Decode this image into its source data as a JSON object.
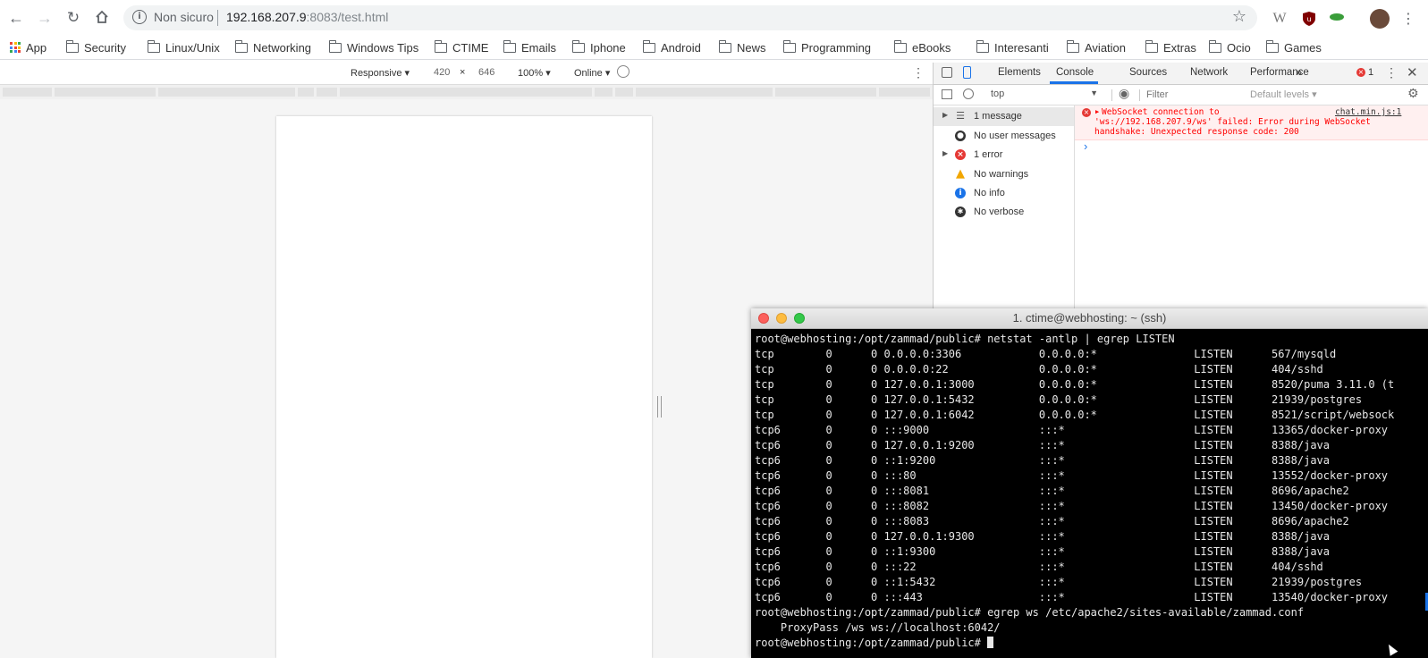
{
  "browser": {
    "security_label": "Non sicuro",
    "url_host": "192.168.207.9",
    "url_rest": ":8083/test.html"
  },
  "bookmarks": [
    {
      "label": "App",
      "icon": "apps-grid-icon"
    },
    {
      "label": "Security",
      "icon": "folder-icon"
    },
    {
      "label": "Linux/Unix",
      "icon": "folder-icon"
    },
    {
      "label": "Networking",
      "icon": "folder-icon"
    },
    {
      "label": "Windows Tips",
      "icon": "folder-icon"
    },
    {
      "label": "CTIME",
      "icon": "folder-icon"
    },
    {
      "label": "Emails",
      "icon": "folder-icon"
    },
    {
      "label": "Iphone",
      "icon": "folder-icon"
    },
    {
      "label": "Android",
      "icon": "folder-icon"
    },
    {
      "label": "News",
      "icon": "folder-icon"
    },
    {
      "label": "Programming",
      "icon": "folder-icon"
    },
    {
      "label": "eBooks",
      "icon": "folder-icon"
    },
    {
      "label": "Interesanti",
      "icon": "folder-icon"
    },
    {
      "label": "Aviation",
      "icon": "folder-icon"
    },
    {
      "label": "Extras",
      "icon": "folder-icon"
    },
    {
      "label": "Ocio",
      "icon": "folder-icon"
    },
    {
      "label": "Games",
      "icon": "folder-icon"
    }
  ],
  "device_toolbar": {
    "mode": "Responsive",
    "width": "420",
    "times": "×",
    "height": "646",
    "zoom": "100%",
    "network": "Online"
  },
  "devtools": {
    "tabs": [
      "Elements",
      "Console",
      "Sources",
      "Network",
      "Performance"
    ],
    "active_tab": "Console",
    "more_tabs": "»",
    "error_count": "1",
    "context": "top",
    "filter_placeholder": "Filter",
    "levels": "Default levels",
    "sidebar": [
      {
        "label": "1 message",
        "icon": "list-icon",
        "expandable": true
      },
      {
        "label": "No user messages",
        "icon": "user-icon",
        "expandable": false
      },
      {
        "label": "1 error",
        "icon": "error-icon",
        "expandable": true
      },
      {
        "label": "No warnings",
        "icon": "warning-icon",
        "expandable": false
      },
      {
        "label": "No info",
        "icon": "info-icon",
        "expandable": false
      },
      {
        "label": "No verbose",
        "icon": "bug-icon",
        "expandable": false
      }
    ],
    "error_message": {
      "line1": "WebSocket connection to",
      "line2": "'ws://192.168.207.9/ws' failed: Error during WebSocket",
      "line3": "handshake: Unexpected response code: 200",
      "source": "chat.min.js:1"
    },
    "prompt": "›"
  },
  "terminal": {
    "title": "1. ctime@webhosting: ~ (ssh)",
    "lines": [
      "root@webhosting:/opt/zammad/public# netstat -antlp | egrep LISTEN",
      "tcp        0      0 0.0.0.0:3306            0.0.0.0:*               LISTEN      567/mysqld",
      "tcp        0      0 0.0.0.0:22              0.0.0.0:*               LISTEN      404/sshd",
      "tcp        0      0 127.0.0.1:3000          0.0.0.0:*               LISTEN      8520/puma 3.11.0 (t",
      "tcp        0      0 127.0.0.1:5432          0.0.0.0:*               LISTEN      21939/postgres",
      "tcp        0      0 127.0.0.1:6042          0.0.0.0:*               LISTEN      8521/script/websock",
      "tcp6       0      0 :::9000                 :::*                    LISTEN      13365/docker-proxy",
      "tcp6       0      0 127.0.0.1:9200          :::*                    LISTEN      8388/java",
      "tcp6       0      0 ::1:9200                :::*                    LISTEN      8388/java",
      "tcp6       0      0 :::80                   :::*                    LISTEN      13552/docker-proxy",
      "tcp6       0      0 :::8081                 :::*                    LISTEN      8696/apache2",
      "tcp6       0      0 :::8082                 :::*                    LISTEN      13450/docker-proxy",
      "tcp6       0      0 :::8083                 :::*                    LISTEN      8696/apache2",
      "tcp6       0      0 127.0.0.1:9300          :::*                    LISTEN      8388/java",
      "tcp6       0      0 ::1:9300                :::*                    LISTEN      8388/java",
      "tcp6       0      0 :::22                   :::*                    LISTEN      404/sshd",
      "tcp6       0      0 ::1:5432                :::*                    LISTEN      21939/postgres",
      "tcp6       0      0 :::443                  :::*                    LISTEN      13540/docker-proxy",
      "root@webhosting:/opt/zammad/public# egrep ws /etc/apache2/sites-available/zammad.conf",
      "    ProxyPass /ws ws://localhost:6042/"
    ],
    "prompt": "root@webhosting:/opt/zammad/public# "
  }
}
